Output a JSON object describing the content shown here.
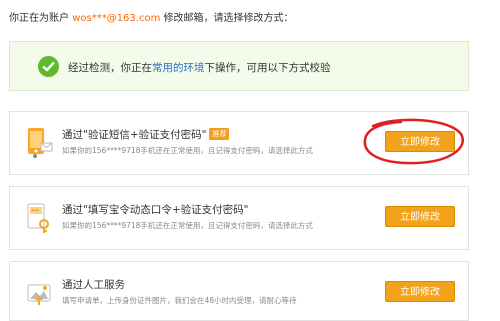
{
  "header": {
    "prefix": "你正在为账户",
    "account": "wos***@163.com",
    "suffix": "修改邮箱，请选择修改方式："
  },
  "notice": {
    "text_before": "经过检测，你正在",
    "highlight": "常用的环境",
    "text_after": "下操作，可用以下方式校验"
  },
  "options": [
    {
      "title": "通过\"验证短信+验证支付密码\"",
      "badge": "推荐",
      "desc": "如果你的156****9718手机还在正常使用，且记得支付密码，请选择此方式",
      "button": "立即修改"
    },
    {
      "title": "通过\"填写宝令动态口令+验证支付密码\"",
      "desc": "如果你的156****9718手机还在正常使用，且记得支付密码，请选择此方式",
      "button": "立即修改"
    },
    {
      "title": "通过人工服务",
      "desc": "填写申请单，上传身份证件图片，我们会在48小时内受理，请耐心等待",
      "button": "立即修改"
    }
  ],
  "colors": {
    "accent": "#f3a21b",
    "link": "#2a70c8",
    "account": "#ff6600",
    "annotation": "#e02020"
  }
}
